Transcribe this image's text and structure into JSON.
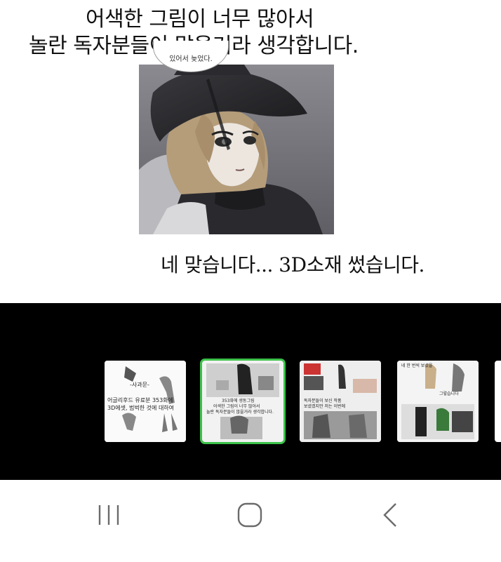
{
  "comic": {
    "caption_line1": "어색한 그림이 너무 많아서",
    "caption_line2": "놀란 독자분들이 많을거라 생각합니다.",
    "speech_bubble": "있어서 늦었다.",
    "caption_answer": "네 맞습니다... 3D소재 썼습니다."
  },
  "thumbnails": [
    {
      "label": "thumbnail-1",
      "title": "-사과문-",
      "line1": "어글리후드 유료분 353화에",
      "line2": "3D에셋, 범벅한 것에 대하여"
    },
    {
      "label": "thumbnail-2",
      "line1": "353화에 생동그림",
      "line2": "어색한 그림이 너무 많아서",
      "line3": "놀란 독자분들이 많을거라 생각합니다."
    },
    {
      "label": "thumbnail-3",
      "line1": "독자분들이 보신 작품",
      "line2": "보셨겠지만 저는 이번에"
    },
    {
      "label": "thumbnail-4",
      "line1": "네 한 번씩 보셨을",
      "line2": "그렇습니다"
    }
  ],
  "nav": {
    "recents_icon": "recents-icon",
    "home_icon": "home-icon",
    "back_icon": "back-icon"
  },
  "colors": {
    "strip_bg": "#000000",
    "active_border": "#3cc24a",
    "nav_icon": "#6b6b6b"
  }
}
